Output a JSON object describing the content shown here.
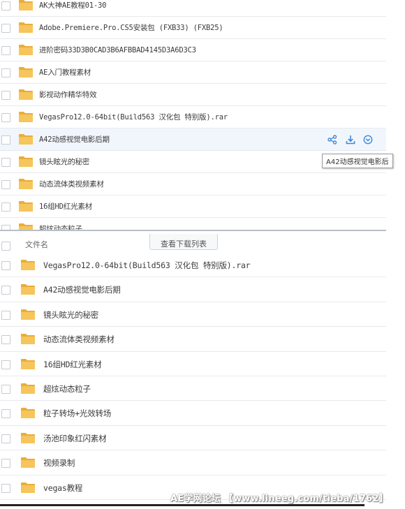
{
  "top_list": {
    "files": [
      {
        "name": "AK大神AE教程01-30"
      },
      {
        "name": "Adobe.Premiere.Pro.CS5安装包 (FXB33) (FXB25)"
      },
      {
        "name": "进阶密码33D3B0CAD3B6AFBBAD4145D3A6D3C3"
      },
      {
        "name": "AE入门教程素材"
      },
      {
        "name": "影视动作精华特效"
      },
      {
        "name": "VegasPro12.0-64bit(Build563 汉化包 特别版).rar"
      },
      {
        "name": "A42动感视觉电影后期"
      },
      {
        "name": "镜头眩光的秘密"
      },
      {
        "name": "动态流体类视频素材"
      },
      {
        "name": "16组HD红光素材"
      },
      {
        "name": "超炫动态粒子"
      }
    ],
    "tooltip": "A42动感视觉电影后",
    "row_actions": [
      "share-icon",
      "download-icon",
      "more-icon"
    ]
  },
  "bottom_list": {
    "header_label": "文件名",
    "header_button": "查看下载列表",
    "files": [
      {
        "name": "VegasPro12.0-64bit(Build563 汉化包 特别版).rar"
      },
      {
        "name": "A42动感视觉电影后期"
      },
      {
        "name": "镜头眩光的秘密"
      },
      {
        "name": "动态流体类视频素材"
      },
      {
        "name": "16组HD红光素材"
      },
      {
        "name": "超炫动态粒子"
      },
      {
        "name": "粒子转场+光效转场"
      },
      {
        "name": "汤池印象红闪素材"
      },
      {
        "name": "视频录制"
      },
      {
        "name": "vegas教程"
      }
    ]
  },
  "watermark": "AE学网论坛 【www.lineeg.com/tieba/1762】",
  "colors": {
    "folder": "#f6c55b",
    "folder_dark": "#e9ad39",
    "accent": "#3d88d6",
    "hover_row": "#f1f6fd"
  }
}
